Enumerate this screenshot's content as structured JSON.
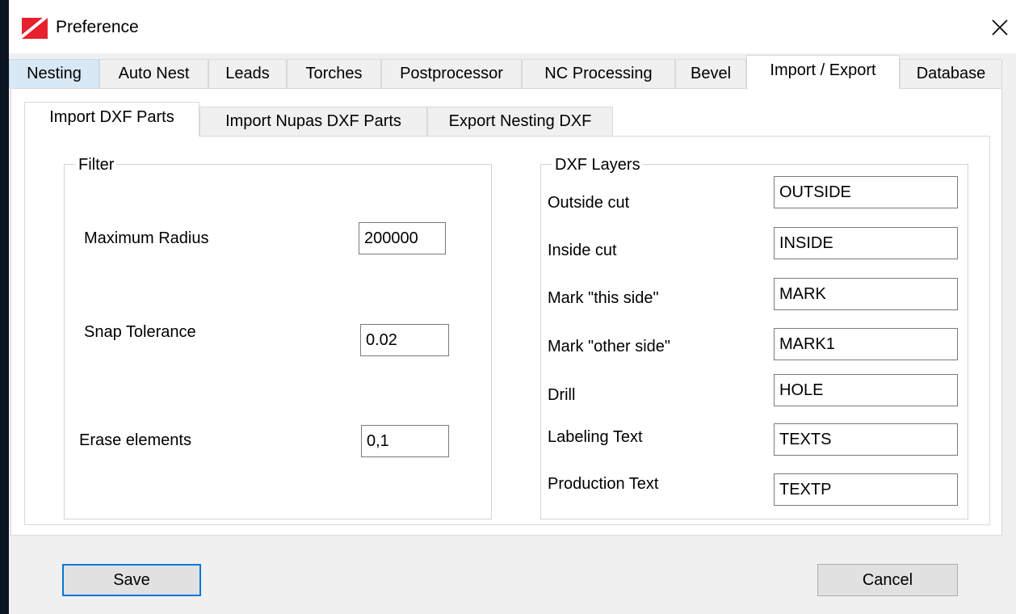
{
  "window": {
    "title": "Preference",
    "close_glyph": "✕",
    "icon": "app-logo-icon",
    "accent_color": "#e6202e"
  },
  "tabs": [
    {
      "label": "Nesting"
    },
    {
      "label": "Auto Nest"
    },
    {
      "label": "Leads"
    },
    {
      "label": "Torches"
    },
    {
      "label": "Postprocessor"
    },
    {
      "label": "NC Processing"
    },
    {
      "label": "Bevel"
    },
    {
      "label": "Import / Export",
      "active": true
    },
    {
      "label": "Database"
    }
  ],
  "subtabs": [
    {
      "label": "Import DXF Parts",
      "active": true
    },
    {
      "label": "Import Nupas DXF Parts"
    },
    {
      "label": "Export Nesting DXF"
    }
  ],
  "filter": {
    "legend": "Filter",
    "max_radius": {
      "label": "Maximum Radius",
      "value": "200000"
    },
    "snap_tolerance": {
      "label": "Snap Tolerance",
      "value": "0.02"
    },
    "erase_elements": {
      "label": "Erase elements",
      "value": "0,1"
    }
  },
  "layers": {
    "legend": "DXF Layers",
    "outside_cut": {
      "label": "Outside cut",
      "value": "OUTSIDE"
    },
    "inside_cut": {
      "label": "Inside cut",
      "value": "INSIDE"
    },
    "mark_this_side": {
      "label": "Mark \"this side\"",
      "value": "MARK"
    },
    "mark_other_side": {
      "label": "Mark \"other side\"",
      "value": "MARK1"
    },
    "drill": {
      "label": "Drill",
      "value": "HOLE"
    },
    "labeling_text": {
      "label": "Labeling Text",
      "value": "TEXTS"
    },
    "production_text": {
      "label": "Production Text",
      "value": "TEXTP"
    }
  },
  "buttons": {
    "save": "Save",
    "cancel": "Cancel"
  }
}
